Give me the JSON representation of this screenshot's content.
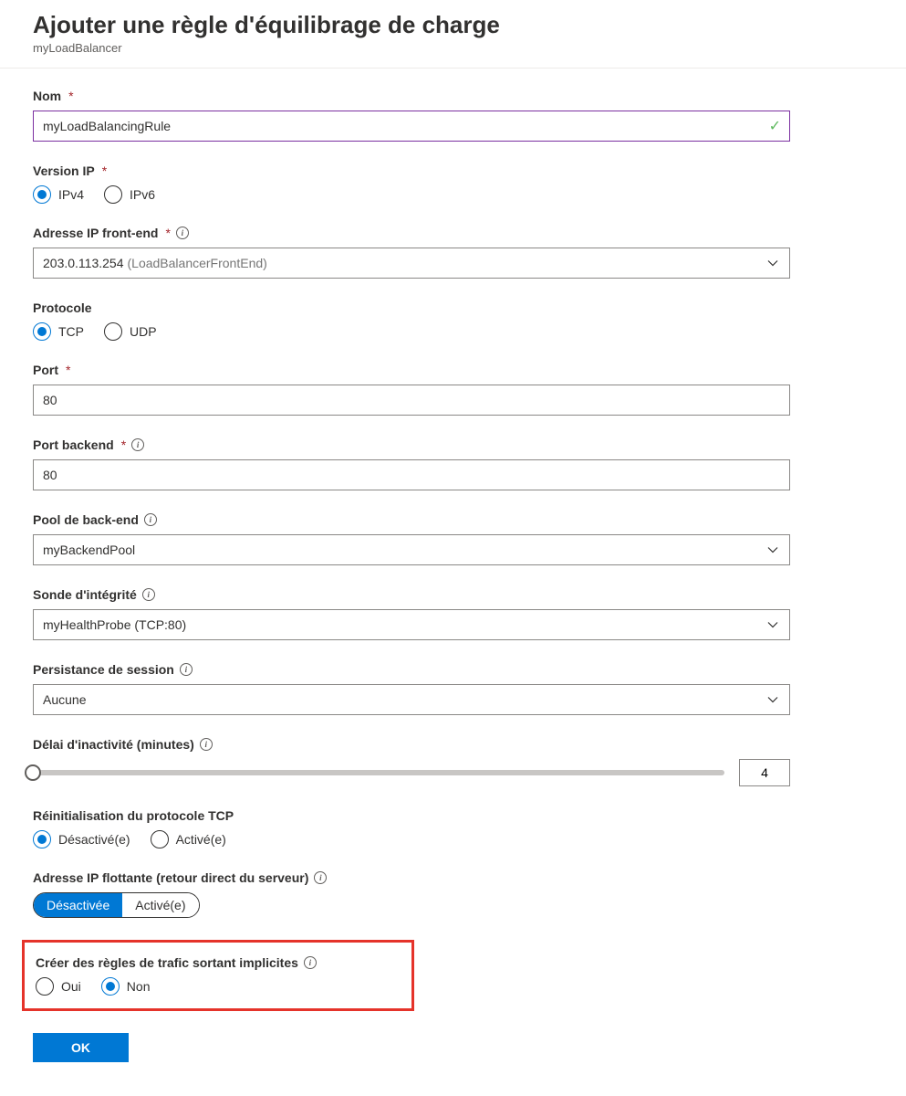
{
  "header": {
    "title": "Ajouter une règle d'équilibrage de charge",
    "subtitle": "myLoadBalancer"
  },
  "fields": {
    "name": {
      "label": "Nom",
      "value": "myLoadBalancingRule"
    },
    "ipVersion": {
      "label": "Version IP",
      "options": {
        "ipv4": "IPv4",
        "ipv6": "IPv6"
      },
      "selected": "ipv4"
    },
    "frontendIp": {
      "label": "Adresse IP front-end",
      "value_ip": "203.0.113.254",
      "value_name": "(LoadBalancerFrontEnd)"
    },
    "protocol": {
      "label": "Protocole",
      "options": {
        "tcp": "TCP",
        "udp": "UDP"
      },
      "selected": "tcp"
    },
    "port": {
      "label": "Port",
      "value": "80"
    },
    "backendPort": {
      "label": "Port backend",
      "value": "80"
    },
    "backendPool": {
      "label": "Pool de back-end",
      "value": "myBackendPool"
    },
    "healthProbe": {
      "label": "Sonde d'intégrité",
      "value": "myHealthProbe (TCP:80)"
    },
    "sessionPersistence": {
      "label": "Persistance de session",
      "value": "Aucune"
    },
    "idleTimeout": {
      "label": "Délai d'inactivité (minutes)",
      "value": "4"
    },
    "tcpReset": {
      "label": "Réinitialisation du protocole TCP",
      "options": {
        "disabled": "Désactivé(e)",
        "enabled": "Activé(e)"
      },
      "selected": "disabled"
    },
    "floatingIp": {
      "label": "Adresse IP flottante (retour direct du serveur)",
      "options": {
        "disabled": "Désactivée",
        "enabled": "Activé(e)"
      },
      "selected": "disabled"
    },
    "implicitOutbound": {
      "label": "Créer des règles de trafic sortant implicites",
      "options": {
        "yes": "Oui",
        "no": "Non"
      },
      "selected": "no"
    }
  },
  "footer": {
    "ok": "OK"
  }
}
